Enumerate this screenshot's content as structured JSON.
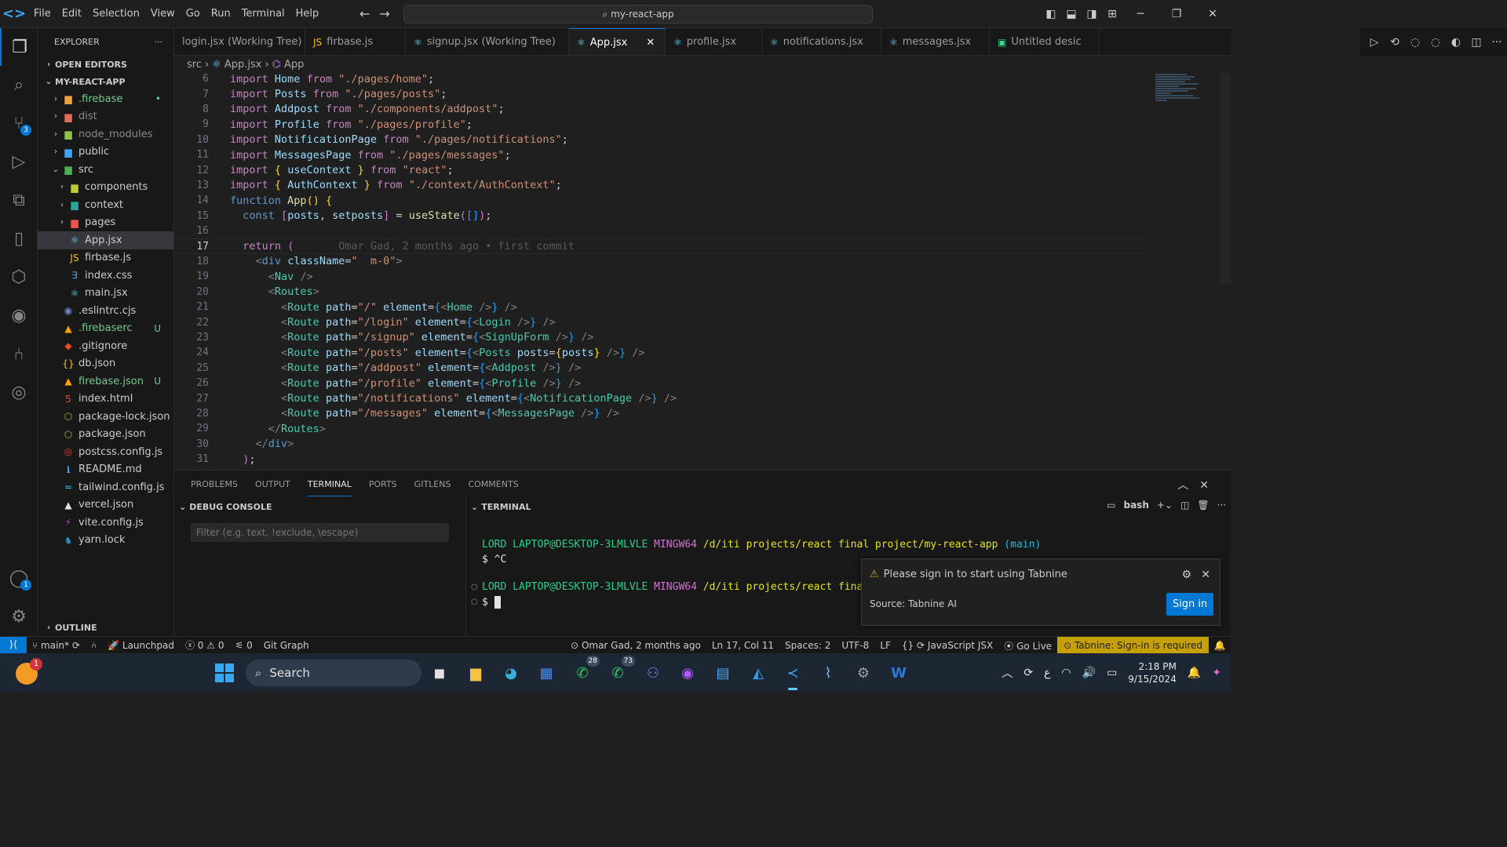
{
  "titlebar": {
    "menu": [
      "File",
      "Edit",
      "Selection",
      "View",
      "Go",
      "Run",
      "Terminal",
      "Help"
    ],
    "search": "my-react-app"
  },
  "sidebar": {
    "title": "EXPLORER",
    "open_editors": "OPEN EDITORS",
    "project": "MY-REACT-APP",
    "items": [
      {
        "name": ".firebase",
        "status": "•"
      },
      {
        "name": "dist"
      },
      {
        "name": "node_modules"
      },
      {
        "name": "public"
      },
      {
        "name": "src"
      },
      {
        "name": "components"
      },
      {
        "name": "context"
      },
      {
        "name": "pages"
      },
      {
        "name": "App.jsx"
      },
      {
        "name": "firbase.js"
      },
      {
        "name": "index.css"
      },
      {
        "name": "main.jsx"
      },
      {
        "name": ".eslintrc.cjs"
      },
      {
        "name": ".firebaserc",
        "status": "U"
      },
      {
        "name": ".gitignore"
      },
      {
        "name": "db.json"
      },
      {
        "name": "firebase.json",
        "status": "U"
      },
      {
        "name": "index.html"
      },
      {
        "name": "package-lock.json"
      },
      {
        "name": "package.json"
      },
      {
        "name": "postcss.config.js"
      },
      {
        "name": "README.md"
      },
      {
        "name": "tailwind.config.js"
      },
      {
        "name": "vercel.json"
      },
      {
        "name": "vite.config.js"
      },
      {
        "name": "yarn.lock"
      }
    ],
    "outline": "OUTLINE"
  },
  "tabs": [
    {
      "label": "login.jsx (Working Tree)"
    },
    {
      "label": "firbase.js"
    },
    {
      "label": "signup.jsx (Working Tree)"
    },
    {
      "label": "App.jsx"
    },
    {
      "label": "profile.jsx"
    },
    {
      "label": "notifications.jsx"
    },
    {
      "label": "messages.jsx"
    },
    {
      "label": "Untitled desic"
    }
  ],
  "breadcrumb": {
    "folder": "src",
    "file": "App.jsx",
    "symbol": "App"
  },
  "editor": {
    "line_numbers": [
      "6",
      "7",
      "8",
      "9",
      "10",
      "11",
      "12",
      "13",
      "14",
      "15",
      "16",
      "17",
      "18",
      "19",
      "20",
      "21",
      "22",
      "23",
      "24",
      "25",
      "26",
      "27",
      "28",
      "29",
      "30",
      "31"
    ],
    "blame": "Omar Gad, 2 months ago • first commit"
  },
  "panel": {
    "tabs": [
      "PROBLEMS",
      "OUTPUT",
      "TERMINAL",
      "PORTS",
      "GITLENS",
      "COMMENTS"
    ],
    "debug_title": "DEBUG CONSOLE",
    "filter_placeholder": "Filter (e.g. text, !exclude, \\escape)",
    "terminal_title": "TERMINAL",
    "shell": "bash",
    "prompt_user": "LORD LAPTOP@DESKTOP-3LMLVLE",
    "prompt_env": "MINGW64",
    "prompt_path": "/d/iti projects/react final project/my-react-app",
    "prompt_branch": "(main)",
    "prompt_path_short": "/d/iti projects/react final pr",
    "line2": "$ ^C",
    "line4": "$ "
  },
  "toast": {
    "message": "Please sign in to start using Tabnine",
    "source": "Source: Tabnine AI",
    "button": "Sign in"
  },
  "statusbar": {
    "branch": "main*",
    "launchpad": "Launchpad",
    "errors": "0",
    "warnings": "0",
    "ports": "0",
    "git_graph": "Git Graph",
    "blame": "Omar Gad, 2 months ago",
    "position": "Ln 17, Col 11",
    "spaces": "Spaces: 2",
    "encoding": "UTF-8",
    "eol": "LF",
    "language": "JavaScript JSX",
    "golive": "Go Live",
    "tabnine": "Tabnine: Sign-in is required"
  },
  "taskbar": {
    "weather_badge": "1",
    "search": "Search",
    "whatsapp_count": "28",
    "whatsapp2_count": "73",
    "time": "2:18 PM",
    "date": "9/15/2024",
    "lang": "ع"
  },
  "activity_badges": {
    "scm": "3",
    "accounts": "1"
  }
}
